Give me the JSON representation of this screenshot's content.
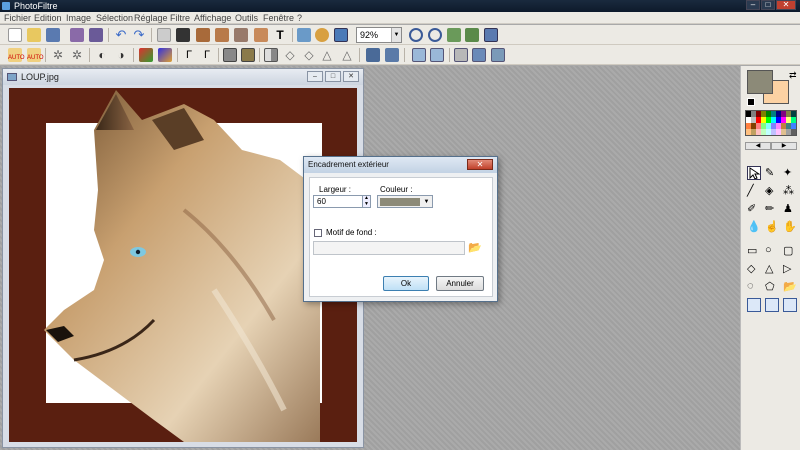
{
  "app": {
    "title": "PhotoFiltre"
  },
  "menu": [
    "Fichier",
    "Edition",
    "Image",
    "Sélection",
    "Réglage",
    "Filtre",
    "Affichage",
    "Outils",
    "Fenêtre",
    "?"
  ],
  "toolbar": {
    "zoom_value": "92%",
    "icons_row1": [
      "new-icon",
      "open-icon",
      "save-icon",
      "print-icon",
      "scan-icon",
      "undo-icon",
      "redo-icon",
      "copy-icon",
      "paste-icon",
      "paste-new-icon",
      "duplicate-icon",
      "crop-icon",
      "text-icon",
      "image-size-icon",
      "canvas-size-icon",
      "fullscreen-icon",
      "zoom-in-icon",
      "zoom-out-icon",
      "fit-icon",
      "actual-size-icon",
      "preview-icon"
    ],
    "icons_row2": [
      "auto-levels-icon",
      "auto-contrast-icon",
      "brightness-minus-icon",
      "brightness-plus-icon",
      "contrast-minus-icon",
      "contrast-plus-icon",
      "saturation-minus-icon",
      "saturation-plus-icon",
      "gamma-minus-icon",
      "gamma-plus-icon",
      "grayscale-icon",
      "sepia-icon",
      "flip-h-icon",
      "blur-icon",
      "sharpen-icon",
      "soften-icon",
      "drop-icon",
      "deform-icon",
      "rotate-left-icon",
      "rotate-right-icon"
    ]
  },
  "document": {
    "title": "LOUP.jpg"
  },
  "dialog": {
    "title": "Encadrement extérieur",
    "close_label": "✕",
    "width_label": "Largeur :",
    "width_value": "60",
    "color_label": "Couleur :",
    "color_value": "#8c8a78",
    "pattern_label": "Motif de fond :",
    "pattern_checked": false,
    "pattern_path": "",
    "ok_label": "Ok",
    "cancel_label": "Annuler"
  },
  "colors": {
    "foreground": "#8c8a78",
    "background": "#fcd2a3",
    "canvas_border": "#5a1f10"
  },
  "palette": [
    "#000000",
    "#808080",
    "#800000",
    "#808000",
    "#008000",
    "#008080",
    "#000080",
    "#800080",
    "#808040",
    "#004040",
    "#ffffff",
    "#c0c0c0",
    "#ff0000",
    "#ffff00",
    "#00ff00",
    "#00ffff",
    "#0000ff",
    "#ff00ff",
    "#ffff80",
    "#00ff80",
    "#ff8040",
    "#804000",
    "#ff8080",
    "#80ff80",
    "#80ffff",
    "#8080ff",
    "#ff80ff",
    "#c08040",
    "#408080",
    "#4080ff",
    "#ffc080",
    "#c0a060",
    "#ffc0c0",
    "#c0ffc0",
    "#c0ffff",
    "#c0c0ff",
    "#ffc0ff",
    "#e0c090",
    "#a0a0a0",
    "#606060"
  ],
  "tools": [
    "pointer-icon",
    "eyedropper-icon",
    "magic-wand-icon",
    "line-icon",
    "fill-icon",
    "spray-icon",
    "brush-icon",
    "pencil-brush-icon",
    "stamp-icon",
    "blur-drop-icon",
    "finger-icon",
    "hand-icon",
    "rectangle-icon",
    "ellipse-icon",
    "triangle-icon",
    "diamond-icon",
    "triangle-up-icon",
    "triangle-right-icon",
    "lasso-icon",
    "polygon-lasso-icon",
    "open-folder-icon",
    "select-all-icon",
    "invert-sel-icon",
    "hide-sel-icon"
  ]
}
